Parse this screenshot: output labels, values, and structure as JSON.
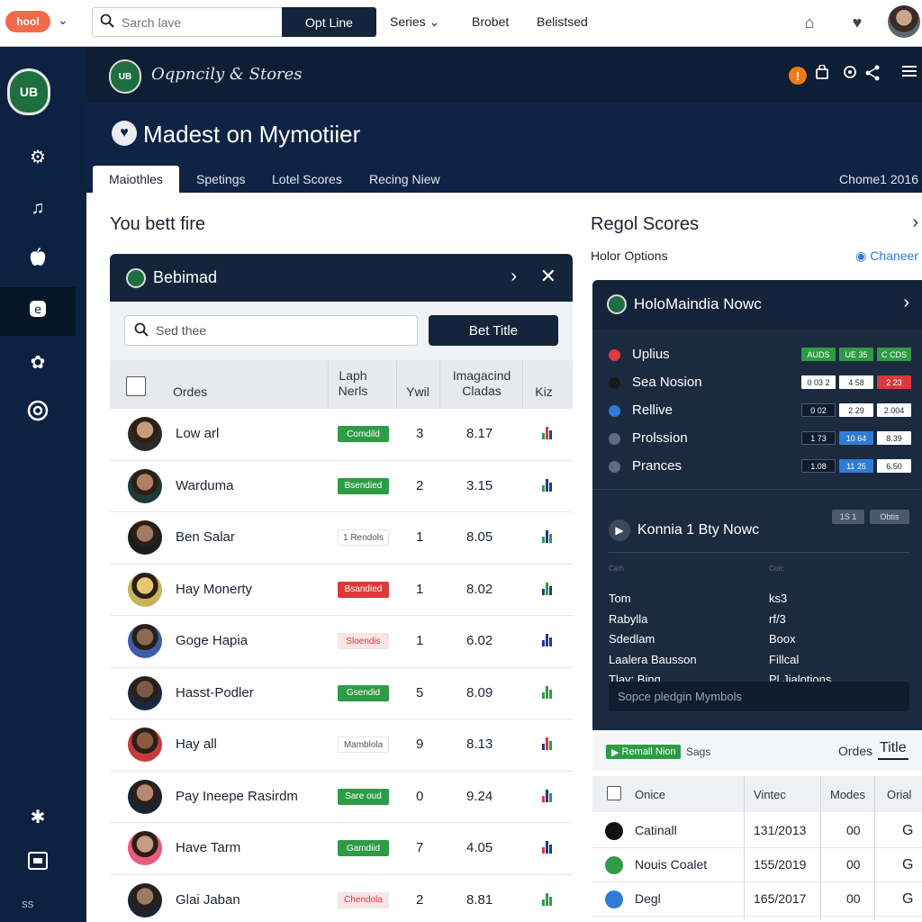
{
  "topbar": {
    "logo_label": "hool",
    "search_placeholder": "Sarch lave",
    "option_button": "Opt Line",
    "nav": [
      {
        "label": "Series"
      },
      {
        "label": "Brobet"
      },
      {
        "label": "Belistsed"
      }
    ]
  },
  "sidebar": {
    "logo": "UB",
    "bottom_label": "SS"
  },
  "header": {
    "brand": "Oqpncily & Stores",
    "logo": "UB",
    "alert_badge": "!",
    "page_title": "Madest on Mymotiier",
    "tabs": [
      {
        "label": "Maiothles"
      },
      {
        "label": "Spetings"
      },
      {
        "label": "Lotel Scores"
      },
      {
        "label": "Recing Niew"
      }
    ],
    "date": "Chome1 2016"
  },
  "left": {
    "title": "You bett fire",
    "panel_title": "Bebimad",
    "search_placeholder": "Sed thee",
    "bet_button": "Bet Title",
    "columns": {
      "ordes": "Ordes",
      "laph_1": "Laph",
      "laph_2": "Nerls",
      "ywil": "Ywil",
      "imp_1": "Imagacind",
      "imp_2": "Cladas",
      "kiz": "Kiz"
    },
    "rows": [
      {
        "name": "Low arl",
        "badge": "Comdild",
        "badge_color": "#2e9b45",
        "n1": "3",
        "n2": "8.17"
      },
      {
        "name": "Warduma",
        "badge": "Bsendied",
        "badge_color": "#2e9b45",
        "n1": "2",
        "n2": "3.15"
      },
      {
        "name": "Ben Salar",
        "badge": "1 Rendols",
        "badge_color": "#ffffff",
        "n1": "1",
        "n2": "8.05"
      },
      {
        "name": "Hay Monerty",
        "badge": "Bsandied",
        "badge_color": "#d93b3b",
        "n1": "1",
        "n2": "8.02"
      },
      {
        "name": "Goge Hapia",
        "badge": "Sloendis",
        "badge_color": "#fce4e4",
        "n1": "1",
        "n2": "6.02"
      },
      {
        "name": "Hasst-Podler",
        "badge": "Gsendid",
        "badge_color": "#2e9b45",
        "n1": "5",
        "n2": "8.09"
      },
      {
        "name": "Hay all",
        "badge": "Mamblola",
        "badge_color": "#ffffff",
        "n1": "9",
        "n2": "8.13"
      },
      {
        "name": "Pay Ineepe Rasirdm",
        "badge": "Sare oud",
        "badge_color": "#2e9b45",
        "n1": "0",
        "n2": "9.24"
      },
      {
        "name": "Have Tarm",
        "badge": "Gamdiid",
        "badge_color": "#2e9b45",
        "n1": "7",
        "n2": "4.05"
      },
      {
        "name": "Glai Jaban",
        "badge": "Chendola",
        "badge_color": "#fce4e4",
        "n1": "2",
        "n2": "8.81"
      }
    ]
  },
  "right": {
    "title": "Regol Scores",
    "holor": "Holor Options",
    "chaneer": "Chaneer",
    "dark_title": "HoloMaindia Nowc",
    "markets": [
      {
        "label": "Uplius",
        "dot": "#e23b3b",
        "odds": [
          "AUDS",
          "UE 35",
          "C CDS"
        ],
        "odds_colors": [
          "#2e9b45",
          "#2e9b45",
          "#2e9b45"
        ]
      },
      {
        "label": "Sea Nosion",
        "dot": "#1a1a1a",
        "odds": [
          "0 03 2",
          "4 58",
          "2 23"
        ],
        "odds_colors": [
          "#ffffff",
          "#ffffff",
          "#d93b3b"
        ]
      },
      {
        "label": "Rellive",
        "dot": "#2e7cd6",
        "odds": [
          "0 02",
          "2.29",
          "2.004"
        ],
        "odds_colors": [
          "#0f1c30",
          "#ffffff",
          "#ffffff"
        ]
      },
      {
        "label": "Prolssion",
        "dot": "#5e6b80",
        "odds": [
          "1 73",
          "10 64",
          "8.39"
        ],
        "odds_colors": [
          "#0f1c30",
          "#2e7cd6",
          "#ffffff"
        ]
      },
      {
        "label": "Prances",
        "dot": "#5e6b80",
        "odds": [
          "1.08",
          "11 25",
          "6.50"
        ],
        "odds_colors": [
          "#0f1c30",
          "#2e7cd6",
          "#ffffff"
        ]
      }
    ],
    "konnia_title": "Konnia 1 Bty Nowc",
    "small_buttons": [
      "1S 1",
      "Obtis"
    ],
    "tiny_left": "Cath",
    "tiny_right": "Cotc",
    "kv": [
      {
        "k": "Tom",
        "v": "ks3"
      },
      {
        "k": "Rabylla",
        "v": "rf/3"
      },
      {
        "k": "Sdedlam",
        "v": "Boox"
      },
      {
        "k": "Laalera Bausson",
        "v": "Fillcal"
      },
      {
        "k": "Tlay: Bing",
        "v": "Pl Jialotions"
      }
    ],
    "dark_input_placeholder": "Sopce pledgin Mymbols",
    "remall": "Remall Nion",
    "sags": "Sags",
    "ordes": "Ordes",
    "title_tab": "Title",
    "mini_cols": {
      "c1": "Onice",
      "c2": "Vintec",
      "c3": "Modes",
      "c4": "Orial"
    },
    "mini_rows": [
      {
        "name": "Catinall",
        "icon_color": "#111111",
        "date": "131/2013",
        "val": "00",
        "g": "G"
      },
      {
        "name": "Nouis Coalet",
        "icon_color": "#2e9b45",
        "date": "155/2019",
        "val": "00",
        "g": "G"
      },
      {
        "name": "Degl",
        "icon_color": "#2e7cd6",
        "date": "165/2017",
        "val": "00",
        "g": "G"
      }
    ]
  }
}
